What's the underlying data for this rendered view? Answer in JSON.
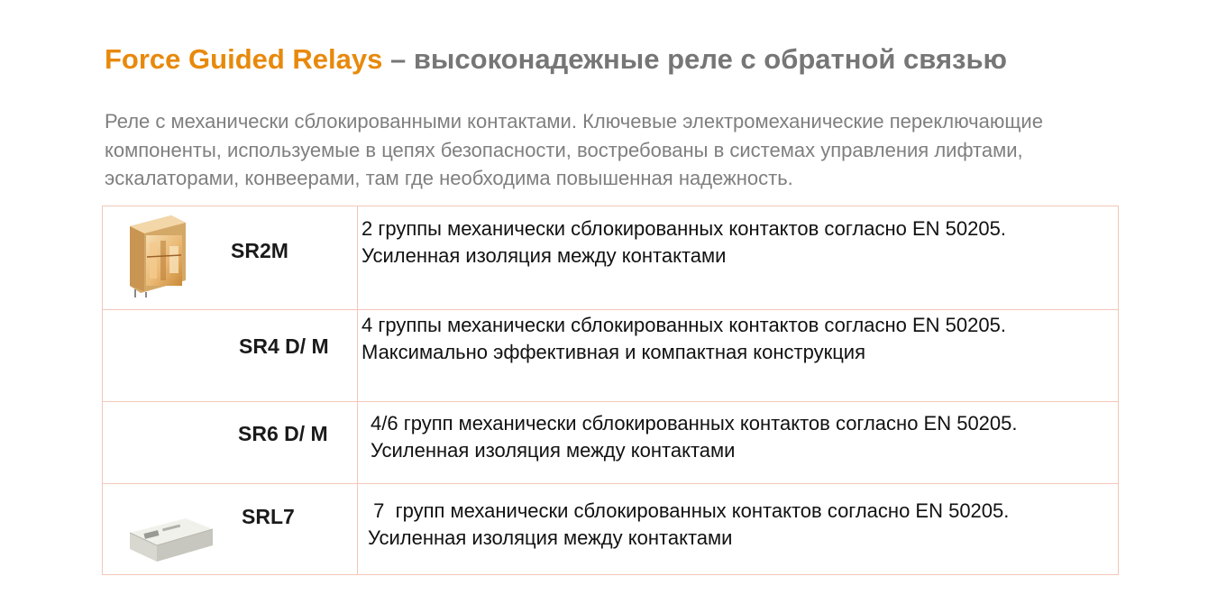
{
  "header": {
    "title_accent": "Force Guided Relays",
    "title_rest": " – высоконадежные реле с обратной связью"
  },
  "intro": {
    "text": "Реле с механически сблокированными контактами. Ключевые электромеханические переключающие компоненты, используемые в цепях безопасности, востребованы в системах управления лифтами, эскалаторами, конвеерами, там где необходима повышенная надежность."
  },
  "relays": [
    {
      "model": "SR2M",
      "line1": "2 группы механически сблокированных контактов согласно EN 50205.",
      "line2": "Усиленная изоляция между контактами"
    },
    {
      "model": "SR4 D/ M",
      "line1": "4 группы механически сблокированных контактов согласно EN 50205.",
      "line2": "Максимально эффективная и компактная конструкция"
    },
    {
      "model": "SR6 D/ M",
      "line1": "4/6  групп механически сблокированных контактов согласно EN 50205.",
      "line2": "Усиленная изоляция между контактами"
    },
    {
      "model": "SRL7",
      "line1": " 7  групп механически сблокированных контактов согласно EN 50205.",
      "line2": "Усиленная изоляция между контактами"
    }
  ],
  "colors": {
    "accent": "#e8890c",
    "heading_gray": "#767676",
    "body_gray": "#7f7f7f",
    "table_border": "#f3c7b9"
  }
}
